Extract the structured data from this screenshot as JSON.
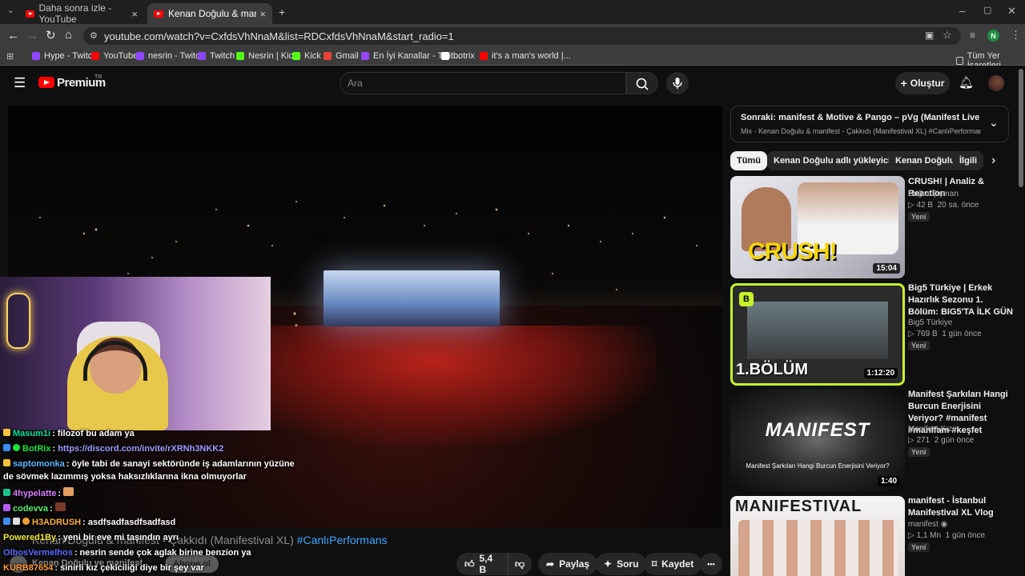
{
  "tabs": [
    {
      "label": "Daha sonra izle - YouTube",
      "close": "×"
    },
    {
      "label": "Kenan Doğulu & manifest - Çak",
      "close": "×"
    }
  ],
  "new_tab": "+",
  "window_controls": {
    "minimize": "–",
    "maximize": "▢",
    "close": "✕"
  },
  "address": {
    "url": "youtube.com/watch?v=CxfdsVhNnaM&list=RDCxfdsVhNnaM&start_radio=1"
  },
  "profile_initial": "N",
  "bookmarks": [
    {
      "label": "Hype - Twitch",
      "color": "#9146ff"
    },
    {
      "label": "YouTube",
      "color": "#ff0000"
    },
    {
      "label": "nesrin - Twitch",
      "color": "#9146ff"
    },
    {
      "label": "Twitch",
      "color": "#9146ff"
    },
    {
      "label": "Nesrin | Kick",
      "color": "#53fc18"
    },
    {
      "label": "Kick",
      "color": "#53fc18"
    },
    {
      "label": "Gmail",
      "color": "#ea4335"
    },
    {
      "label": "En İyi Kanallar - Twit...",
      "color": "#9146ff"
    },
    {
      "label": "botrix",
      "color": "#ffffff"
    },
    {
      "label": "it's a man's world |...",
      "color": "#ff0000"
    }
  ],
  "all_bookmarks": "Tüm Yer İşaretleri",
  "youtube": {
    "logo_text": "Premium",
    "logo_region": "TR",
    "search_placeholder": "Ara",
    "create_label": "Oluştur"
  },
  "video": {
    "title_main": "Kenan Doğulu & manifest - Çakkıdı (Manifestival XL)",
    "title_tag": "#CanlıPerformans",
    "channel": "Kenan Doğulu",
    "channel_extra": "ve manifest",
    "subscribe_label": "Abone ol",
    "likes": "5,4 B",
    "share_label": "Paylaş",
    "ask_label": "Soru",
    "save_label": "Kaydet",
    "more_label": "•••"
  },
  "chat": [
    {
      "user": "Masum1i",
      "text": ": filozof bu adam ya",
      "color": "#00e5a0",
      "badge": "#f6c338"
    },
    {
      "user": "BotRix",
      "text": ":",
      "link": "https://discord.com/invite/rXRNh3NKK2",
      "color": "#19e63a",
      "badge": "#3a8ef6"
    },
    {
      "user": "saptomonka",
      "text": ": öyle tabi de sanayi sektöründe iş adamlarının yüzüne",
      "color": "#5ab6ff",
      "badge": "#f6c338"
    },
    {
      "user": "",
      "text": "de sövmek lazımmış yoksa haksızlıklarına ikna olmuyorlar",
      "color": "#ffffff",
      "badge": ""
    },
    {
      "user": "4hypelatte",
      "text": ":",
      "color": "#d77cff",
      "badge": "#19c38a"
    },
    {
      "user": "codevva",
      "text": ":",
      "color": "#58f06e",
      "badge": "#b35cff"
    },
    {
      "user": "H3ADRUSH",
      "text": ": asdfsadfasdfsadfasd",
      "color": "#ffb23c",
      "badge": "#3a8ef6"
    },
    {
      "user": "Powered1By",
      "text": ": yeni bir eve mi taşındın ayrı",
      "color": "#f0e83c",
      "badge": ""
    },
    {
      "user": "OlbosVermelhos",
      "text": ": nesrin sende çok aglak birine benzion ya",
      "color": "#5a6cff",
      "badge": ""
    },
    {
      "user": "KURB87654",
      "text": ": sinirli kız çekiciliği diye bir şey var",
      "color": "#ff9a3c",
      "badge": ""
    }
  ],
  "up_next": {
    "heading": "Sonraki: manifest & Motive & Pango – pVg (Manifest Live Remix) | Offi...",
    "sub": "Mix - Kenan Doğulu & manifest - Çakkıdı (Manifestival XL) #CanlıPerformans"
  },
  "chips": [
    "Tümü",
    "Kenan Doğulu adlı yükleyiciden",
    "Kenan Doğulu",
    "İlgili"
  ],
  "recommendations": [
    {
      "title": "CRUSH! | Analiz & Reaction",
      "channel": "Buğra Şişman",
      "views": "42 B",
      "age": "20 sa. önce",
      "badge": "Yeni",
      "duration": "15:04",
      "thumb_text": "CRUSH!"
    },
    {
      "title": "Big5 Türkiye | Erkek Hazırlık Sezonu 1. Bölüm: BIG5'TA İLK GÜN",
      "channel": "Big5 Türkiye",
      "views": "769 B",
      "age": "1 gün önce",
      "badge": "Yeni",
      "duration": "1:12:20",
      "thumb_text": "1.BÖLÜM"
    },
    {
      "title": "Manifest Şarkıları Hangi Burcun Enerjisini Veriyor? #manifest #manifam #keşfet",
      "channel": "Manifest Kızı",
      "views": "271",
      "age": "2 gün önce",
      "badge": "Yeni",
      "duration": "1:40",
      "thumb_text": "MANIFEST",
      "thumb_sub": "Manifest Şarkıları Hangi Burcun Enerjisini Veriyor?"
    },
    {
      "title": "manifest - İstanbul Manifestival XL Vlog",
      "channel": "manifest",
      "views": "1,1 Mn",
      "age": "1 gün önce",
      "badge": "Yeni",
      "duration": "",
      "thumb_text": "MANIFESTIVAL"
    }
  ],
  "views_prefix": "▷"
}
